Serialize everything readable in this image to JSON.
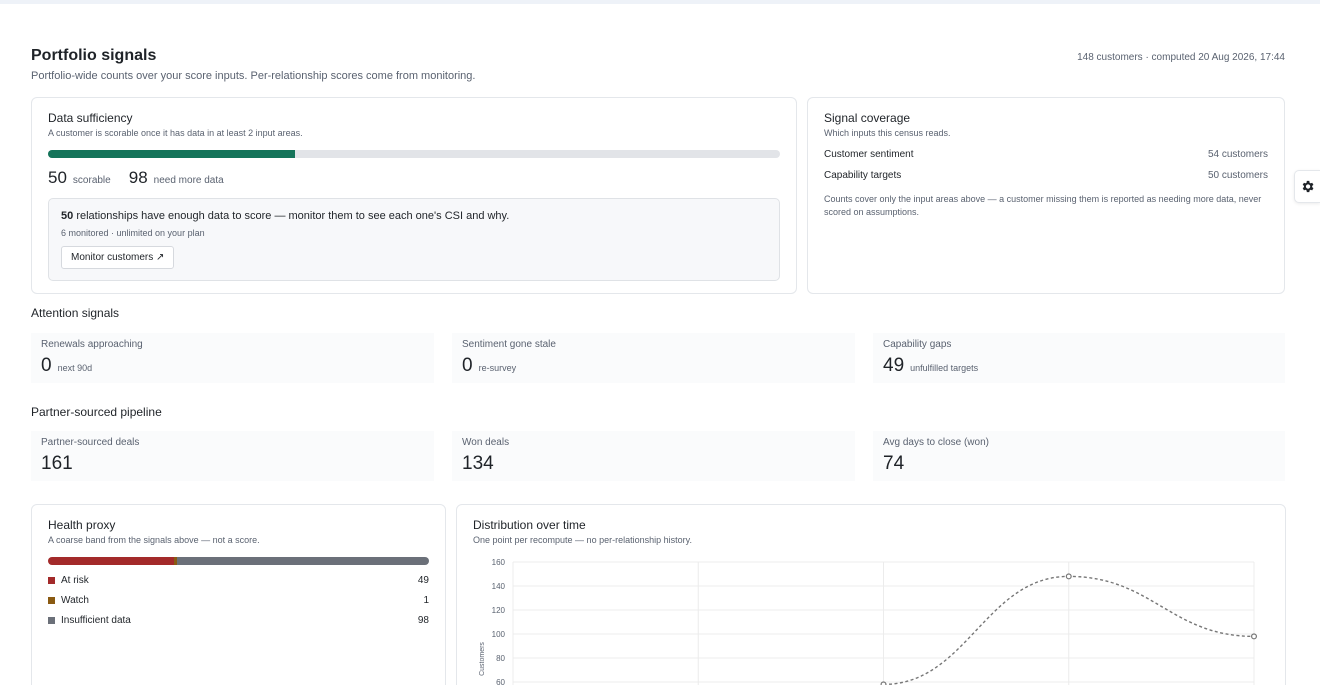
{
  "header": {
    "title": "Portfolio signals",
    "subtitle": "Portfolio-wide counts over your score inputs. Per-relationship scores come from monitoring.",
    "meta": "148 customers · computed 20 Aug 2026, 17:44"
  },
  "sufficiency": {
    "title": "Data sufficiency",
    "sub": "A customer is scorable once it has data in at least 2 input areas.",
    "scorable_fraction": 0.338,
    "scorable_count": "50",
    "scorable_label": "scorable",
    "need_count": "98",
    "need_label": "need more data",
    "monitor_count": "50",
    "monitor_text": "relationships have enough data to score — monitor them to see each one's CSI and why.",
    "monitor_small": "6 monitored · unlimited on your plan",
    "monitor_button": "Monitor customers ↗"
  },
  "coverage": {
    "title": "Signal coverage",
    "sub": "Which inputs this census reads.",
    "rows": [
      {
        "label": "Customer sentiment",
        "value": "54 customers"
      },
      {
        "label": "Capability targets",
        "value": "50 customers"
      }
    ],
    "note": "Counts cover only the input areas above — a customer missing them is reported as needing more data, never scored on assumptions."
  },
  "attention": {
    "heading": "Attention signals",
    "tiles": [
      {
        "label": "Renewals approaching",
        "value": "0",
        "unit": "next 90d"
      },
      {
        "label": "Sentiment gone stale",
        "value": "0",
        "unit": "re-survey"
      },
      {
        "label": "Capability gaps",
        "value": "49",
        "unit": "unfulfilled targets"
      }
    ]
  },
  "pipeline": {
    "heading": "Partner-sourced pipeline",
    "tiles": [
      {
        "label": "Partner-sourced deals",
        "value": "161"
      },
      {
        "label": "Won deals",
        "value": "134"
      },
      {
        "label": "Avg days to close (won)",
        "value": "74"
      }
    ]
  },
  "health": {
    "title": "Health proxy",
    "sub": "A coarse band from the signals above — not a score.",
    "bands": [
      {
        "label": "At risk",
        "count": "49",
        "value": 49,
        "color": "#a32a2a"
      },
      {
        "label": "Watch",
        "count": "1",
        "value": 1,
        "color": "#8a5a12"
      },
      {
        "label": "Insufficient data",
        "count": "98",
        "value": 98,
        "color": "#6b7079"
      }
    ]
  },
  "distribution": {
    "title": "Distribution over time",
    "sub": "One point per recompute — no per-relationship history."
  },
  "chart_data": {
    "type": "line",
    "ylabel": "Customers",
    "y_ticks": [
      "160",
      "140",
      "120",
      "100",
      "80",
      "60"
    ],
    "ylim": [
      60,
      160
    ],
    "grid": true,
    "series": [
      {
        "values": [
          58,
          148,
          98
        ],
        "x_index": [
          2,
          3,
          4
        ],
        "style": "dashed",
        "color": "#777777"
      }
    ],
    "x_slots": 5
  },
  "icons": {
    "settings": "gear-icon"
  }
}
